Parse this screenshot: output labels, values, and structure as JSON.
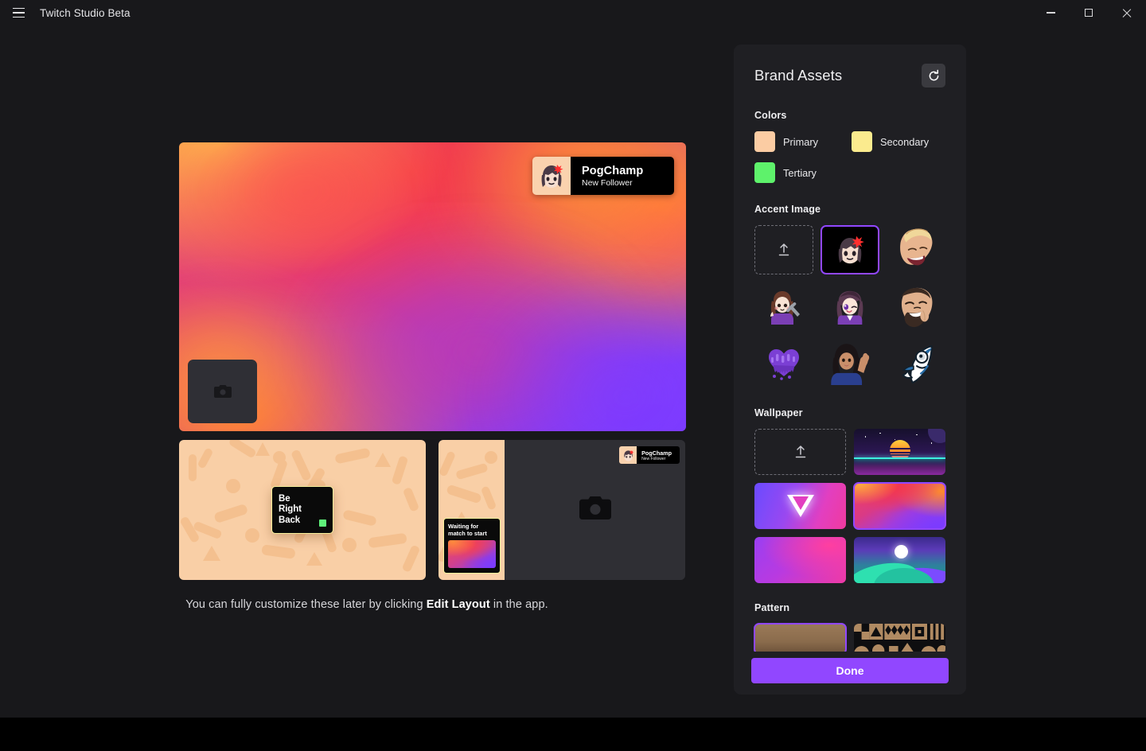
{
  "window": {
    "title": "Twitch Studio Beta",
    "menu_icon": "hamburger-icon",
    "minimize_label": "Minimize",
    "maximize_label": "Maximize",
    "close_label": "Close"
  },
  "preview": {
    "alert": {
      "name": "PogChamp",
      "subtitle": "New Follower",
      "avatar_icon": "angry-anime-girl-emote"
    },
    "camera_placeholder_icon": "camera-icon",
    "caption_before": "You can fully customize these later by clicking ",
    "caption_bold": "Edit Layout",
    "caption_after": " in the app.",
    "brb_card": {
      "line1": "Be",
      "line2": "Right",
      "line3": "Back",
      "status_color": "#5ef27a",
      "border_color": "#f7f09b"
    },
    "waiting_card": {
      "line1": "Waiting for",
      "line2": "match to start",
      "border_color": "#f7f09b"
    },
    "mini_alert": {
      "name": "PogChamp",
      "subtitle": "New Follower"
    }
  },
  "panel": {
    "title": "Brand Assets",
    "refresh_icon": "refresh-icon",
    "colors": {
      "label": "Colors",
      "items": [
        {
          "name": "Primary",
          "hex": "#fbcca3"
        },
        {
          "name": "Secondary",
          "hex": "#fbeb8e"
        },
        {
          "name": "Tertiary",
          "hex": "#5ef26b"
        }
      ]
    },
    "accent_image": {
      "label": "Accent Image",
      "upload_icon": "upload-icon",
      "items": [
        {
          "icon": "upload-placeholder",
          "selected": false
        },
        {
          "icon": "angry-anime-girl-emote",
          "selected": true
        },
        {
          "icon": "laughing-man-emote",
          "selected": false
        },
        {
          "icon": "anime-girl-wrench-emote",
          "selected": false
        },
        {
          "icon": "winking-anime-girl-emote",
          "selected": false
        },
        {
          "icon": "bearded-man-laughing-emote",
          "selected": false
        },
        {
          "icon": "melting-purple-heart-emote",
          "selected": false
        },
        {
          "icon": "waving-woman-emote",
          "selected": false
        },
        {
          "icon": "fish-emote",
          "selected": false
        }
      ]
    },
    "wallpaper": {
      "label": "Wallpaper",
      "upload_icon": "upload-icon",
      "items": [
        {
          "name": "upload-placeholder",
          "selected": false
        },
        {
          "name": "retro-sunset",
          "selected": false
        },
        {
          "name": "glowing-triangle",
          "selected": false
        },
        {
          "name": "orange-purple-waves",
          "selected": true
        },
        {
          "name": "pink-purple-blob",
          "selected": false
        },
        {
          "name": "teal-dunes-moon",
          "selected": false
        }
      ]
    },
    "pattern": {
      "label": "Pattern",
      "items": [
        {
          "name": "tan-gradient-pattern",
          "selected": true
        },
        {
          "name": "geometric-shapes-pattern",
          "selected": false
        }
      ]
    },
    "done_label": "Done",
    "accent_color": "#9147ff"
  }
}
